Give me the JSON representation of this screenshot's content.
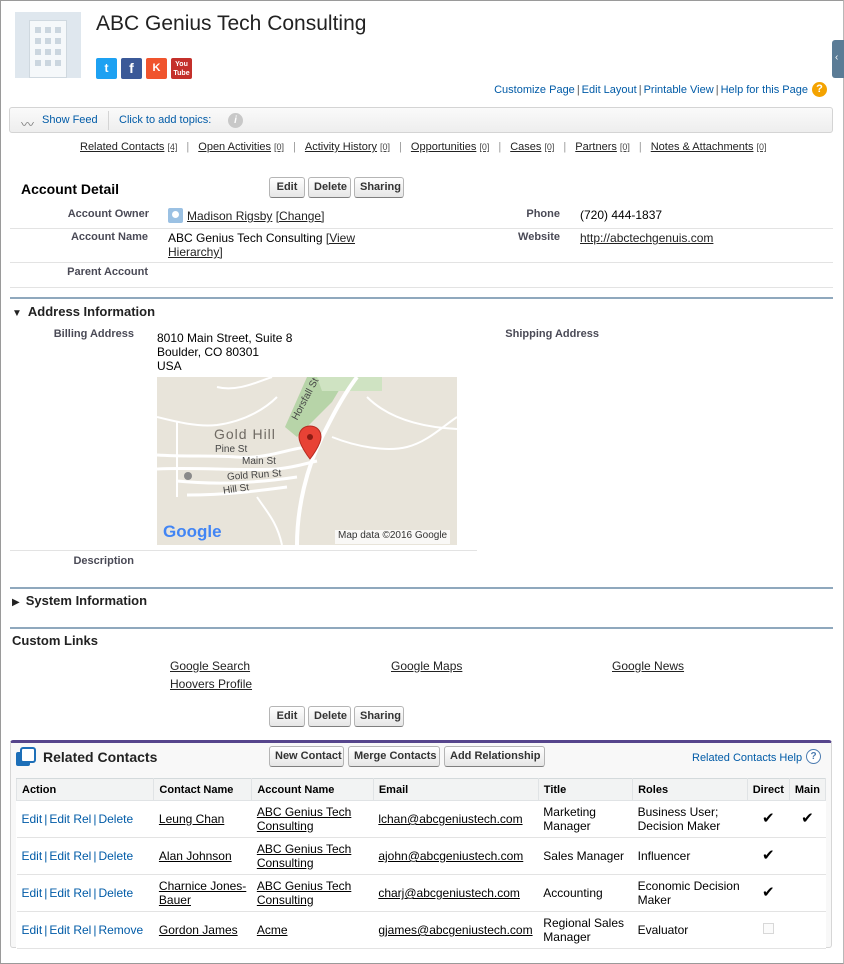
{
  "account": {
    "name": "ABC Genius Tech Consulting",
    "social": [
      "twitter",
      "facebook",
      "klout",
      "youtube"
    ]
  },
  "top_links": [
    "Customize Page",
    "Edit Layout",
    "Printable View",
    "Help for this Page"
  ],
  "feed": {
    "show_feed": "Show Feed",
    "add_topics": "Click to add topics:"
  },
  "related_links": [
    {
      "label": "Related Contacts",
      "count": "[4]"
    },
    {
      "label": "Open Activities",
      "count": "[0]"
    },
    {
      "label": "Activity History",
      "count": "[0]"
    },
    {
      "label": "Opportunities",
      "count": "[0]"
    },
    {
      "label": "Cases",
      "count": "[0]"
    },
    {
      "label": "Partners",
      "count": "[0]"
    },
    {
      "label": "Notes & Attachments",
      "count": "[0]"
    }
  ],
  "buttons": {
    "edit": "Edit",
    "delete": "Delete",
    "sharing": "Sharing"
  },
  "detail": {
    "title": "Account Detail",
    "owner_label": "Account Owner",
    "owner_value": "Madison Rigsby",
    "owner_change": "[Change]",
    "phone_label": "Phone",
    "phone_value": "(720) 444-1837",
    "name_label": "Account Name",
    "name_value": "ABC Genius Tech Consulting",
    "name_hier_1": "[View",
    "name_hier_2": "Hierarchy]",
    "website_label": "Website",
    "website_value": "http://abctechgenuis.com",
    "parent_label": "Parent Account"
  },
  "address": {
    "title": "Address Information",
    "billing_label": "Billing Address",
    "billing_line1": "8010 Main Street, Suite 8",
    "billing_line2": "Boulder, CO 80301",
    "billing_line3": "USA",
    "shipping_label": "Shipping Address",
    "description_label": "Description",
    "map": {
      "area_label": "Gold Hill",
      "streets": [
        "Pine St",
        "Main St",
        "Gold Run St",
        "Hill St",
        "Horsfall St"
      ],
      "provider": "Google",
      "attribution": "Map data ©2016 Google"
    }
  },
  "system_info": {
    "title": "System Information"
  },
  "custom_links": {
    "title": "Custom Links",
    "items": [
      "Google Search",
      "Google Maps",
      "Google News",
      "Hoovers Profile"
    ]
  },
  "related_contacts": {
    "title": "Related Contacts",
    "buttons": [
      "New Contact",
      "Merge Contacts",
      "Add Relationship"
    ],
    "help": "Related Contacts Help",
    "columns": [
      "Action",
      "Contact Name",
      "Account Name",
      "Email",
      "Title",
      "Roles",
      "Direct",
      "Main"
    ],
    "rows": [
      {
        "a1": "Edit",
        "a2": "Edit Rel",
        "a3": "Delete",
        "name": "Leung Chan",
        "account": "ABC Genius Tech Consulting",
        "email": "lchan@abcgeniustech.com",
        "title": "Marketing Manager",
        "roles": "Business User; Decision Maker",
        "direct": true,
        "main": true
      },
      {
        "a1": "Edit",
        "a2": "Edit Rel",
        "a3": "Delete",
        "name": "Alan Johnson",
        "account": "ABC Genius Tech Consulting",
        "email": "ajohn@abcgeniustech.com",
        "title": "Sales Manager",
        "roles": "Influencer",
        "direct": true,
        "main": false
      },
      {
        "a1": "Edit",
        "a2": "Edit Rel",
        "a3": "Delete",
        "name": "Charnice Jones-Bauer",
        "account": "ABC Genius Tech Consulting",
        "email": "charj@abcgeniustech.com",
        "title": "Accounting",
        "roles": "Economic Decision Maker",
        "direct": true,
        "main": false
      },
      {
        "a1": "Edit",
        "a2": "Edit Rel",
        "a3": "Remove",
        "name": "Gordon James",
        "account": "Acme",
        "email": "gjames@abcgeniustech.com",
        "title": "Regional Sales Manager",
        "roles": "Evaluator",
        "direct": false,
        "main": false
      }
    ]
  }
}
